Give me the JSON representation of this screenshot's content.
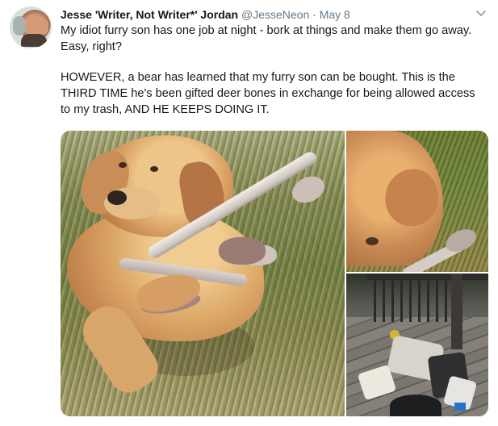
{
  "tweet": {
    "author_name": "Jesse 'Writer, Not Writer*' Jordan",
    "handle": "@JesseNeon",
    "separator": "·",
    "date": "May 8",
    "menu_icon": "chevron-down-icon",
    "text": {
      "paragraph_1_line_1": "My idiot furry son has one job at night - bork at things and make them go away.",
      "paragraph_1_line_2": "Easy, right?",
      "paragraph_2_line_1": "HOWEVER, a bear has learned that my furry son can be bought. This is the",
      "paragraph_2_line_2": "THIRD TIME he's been gifted deer bones in exchange for being allowed access",
      "paragraph_2_line_3": "to my trash, AND HE KEEPS DOING IT."
    },
    "media": {
      "photo_count": 3
    }
  },
  "colors": {
    "author_text": "#14171a",
    "secondary_text": "#657786",
    "icon": "#8899a6",
    "background": "#ffffff"
  }
}
